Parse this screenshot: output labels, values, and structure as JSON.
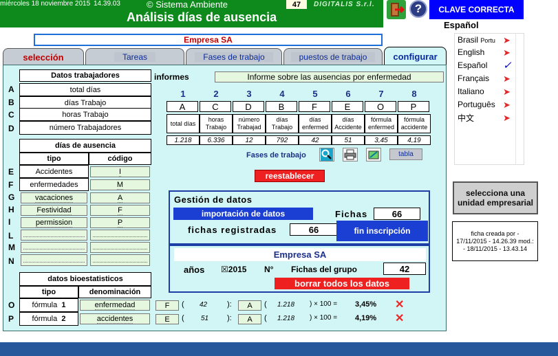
{
  "header": {
    "date": "miércoles 18 noviembre 2015",
    "time": "14.39.03",
    "system": "© Sistema Ambiente",
    "number": "47",
    "brand": "DIGITALIS S.r.l.",
    "title": "Análisis días de ausencia"
  },
  "top_right": {
    "help_glyph": "?",
    "clave": "CLAVE CORRECTA",
    "language_title": "Español",
    "languages": [
      {
        "label": "Brasil",
        "sub": "Portu",
        "active": false
      },
      {
        "label": "English",
        "sub": "",
        "active": false
      },
      {
        "label": "Español",
        "sub": "",
        "active": true
      },
      {
        "label": "Français",
        "sub": "",
        "active": false
      },
      {
        "label": "Italiano",
        "sub": "",
        "active": false
      },
      {
        "label": "Portuguê",
        "sub": "s",
        "active": false
      },
      {
        "label": "中文",
        "sub": "",
        "active": false
      }
    ]
  },
  "company": "Empresa SA",
  "tabs": [
    "selección",
    "Tareas",
    "Fases de trabajo",
    "puestos de trabajo",
    "configurar"
  ],
  "workers": {
    "title": "Datos trabajadores",
    "rows": [
      {
        "letter": "A",
        "label": "total días"
      },
      {
        "letter": "B",
        "label": "días Trabajo"
      },
      {
        "letter": "C",
        "label": "horas Trabajo"
      },
      {
        "letter": "D",
        "label": "número Trabajadores"
      }
    ]
  },
  "absence": {
    "title": "días de ausencia",
    "col_type": "tipo",
    "col_code": "código",
    "rows": [
      {
        "letter": "E",
        "type": "Accidentes",
        "code": "I"
      },
      {
        "letter": "F",
        "type": "enfermedades",
        "code": "M"
      },
      {
        "letter": "G",
        "type": "vacaciones",
        "code": "A"
      },
      {
        "letter": "H",
        "type": "Festividad",
        "code": "F"
      },
      {
        "letter": "I",
        "type": "permission",
        "code": "P"
      },
      {
        "letter": "L",
        "type": "",
        "code": ""
      },
      {
        "letter": "M",
        "type": "",
        "code": ""
      },
      {
        "letter": "N",
        "type": "",
        "code": ""
      }
    ]
  },
  "bio": {
    "title": "datos bioestatisticos",
    "col_type": "tipo",
    "col_name": "denominación",
    "rows": [
      {
        "letter": "O",
        "type": "fórmula",
        "num": "1",
        "name": "enfermedad",
        "num_code": "F",
        "num_value": "42",
        "den_code": "A",
        "den_value": "1.218",
        "mult": "× 100 =",
        "result": "3,45%"
      },
      {
        "letter": "P",
        "type": "fórmula",
        "num": "2",
        "name": "accidentes",
        "num_code": "E",
        "num_value": "51",
        "den_code": "A",
        "den_value": "1.218",
        "mult": "× 100 =",
        "result": "4,19%"
      }
    ]
  },
  "reports": {
    "label": "informes",
    "selected": "Informe sobre las ausencias por enfermedad",
    "columns": [
      {
        "n": "1",
        "code": "A",
        "head": "total días",
        "value": "1.218"
      },
      {
        "n": "2",
        "code": "C",
        "head": "horas Trabajo",
        "value": "6.336"
      },
      {
        "n": "3",
        "code": "D",
        "head": "número Trabajad",
        "value": "12"
      },
      {
        "n": "4",
        "code": "B",
        "head": "días Trabajo",
        "value": "792"
      },
      {
        "n": "5",
        "code": "F",
        "head": "días enfermed",
        "value": "42"
      },
      {
        "n": "6",
        "code": "E",
        "head": "días Accidente",
        "value": "51"
      },
      {
        "n": "7",
        "code": "O",
        "head": "fórmula enfermed",
        "value": "3,45"
      },
      {
        "n": "8",
        "code": "P",
        "head": "fórmula accidente",
        "value": "4,19"
      }
    ]
  },
  "phases": {
    "label": "Fases de trabajo",
    "table_btn": "tabla"
  },
  "reset": "reestablecer",
  "gestion": {
    "title": "Gestión de datos",
    "import_btn": "importación de datos",
    "fichas_label": "Fichas",
    "fichas_value": "66",
    "registered_label": "fichas registradas",
    "registered_value": "66",
    "end_btn": "fin inscripción"
  },
  "group": {
    "company": "Empresa SA",
    "years_label": "años",
    "checkbox": "☒",
    "year": "2015",
    "n_label": "N°",
    "group_label": "Fichas del grupo",
    "group_value": "42",
    "delete_btn": "borrar todos los datos"
  },
  "select_unit": "selecciona una unidad empresarial",
  "ficha_info": "ficha creada por - 17/11/2015 - 14.26.39 mod.: - 18/11/2015 - 13.43.14",
  "colors": {
    "header": "#0e8a1c",
    "panel": "#d2f6f6",
    "accent_blue": "#1a3fd2",
    "alert_red": "#ee2020"
  }
}
